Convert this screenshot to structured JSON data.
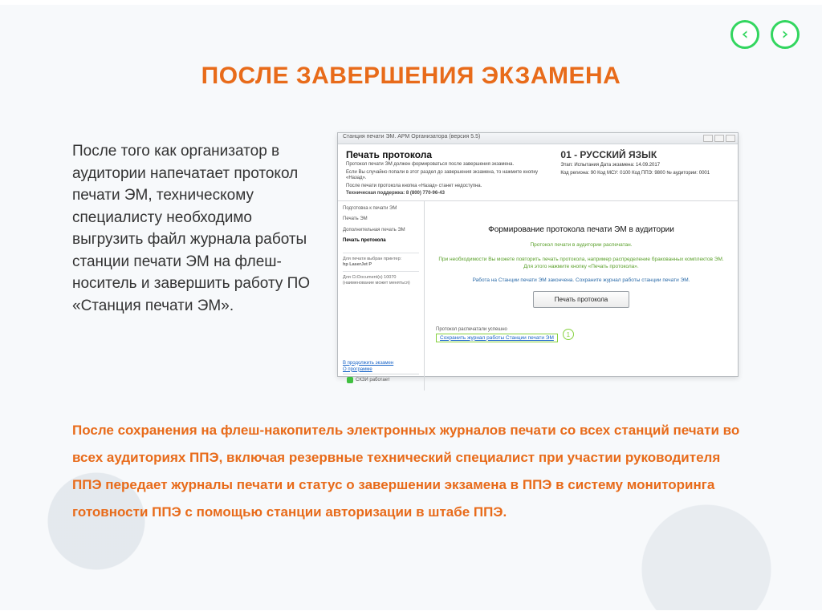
{
  "title": "ПОСЛЕ ЗАВЕРШЕНИЯ ЭКЗАМЕНА",
  "body": "После того как организатор в аудитории напечатает протокол печати ЭМ, техническому специалисту необходимо выгрузить файл журнала работы станции печати ЭМ на флеш-носитель и завершить работу ПО «Станция печати ЭМ».",
  "footer": "После сохранения на флеш-накопитель электронных журналов печати со всех станций печати во всех аудиториях ППЭ, включая резервные технический специалист при участии руководителя ППЭ передает журналы печати и статус        о завершении экзамена в ППЭ в систему мониторинга готовности ППЭ с помощью станции авторизации в штабе ППЭ.",
  "ss": {
    "titlebar": "Станция печати ЭМ. АРМ Организатора (версия 5.5)",
    "header_left_title": "Печать протокола",
    "header_left_sub1": "Протокол печати ЭМ должен формироваться после завершения экзамена.",
    "header_left_sub2": "Если Вы случайно попали в этот раздел до завершения экзамена, то нажмите кнопку «Назад».",
    "header_left_sub3": "После печати протокола кнопка «Назад» станет недоступна.",
    "header_left_support": "Техническая поддержка:  8 (800) 770-96-43",
    "header_right_title": "01 - РУССКИЙ ЯЗЫК",
    "header_right_meta1": "Этап: Испытания   Дата экзамена: 14.09.2017",
    "header_right_meta2": "Код региона: 90   Код МСУ: 0100   Код ППЭ: 9800   № аудитории: 0001",
    "side": {
      "step1": "Подготовка к печати ЭМ",
      "step2": "Печать ЭМ",
      "step3": "Дополнительная печать ЭМ",
      "step4": "Печать протокола",
      "printer_label": "Для печати выбран принтер:",
      "printer_name": "hp LaserJet P",
      "printer_note": "Для Сі:Document(s) 10070 (наименование может меняться)",
      "link1": "В продолжить экзамен",
      "link2": "О программе",
      "status": "СКЗИ работает"
    },
    "main": {
      "title": "Формирование протокола печати ЭМ в аудитории",
      "green1": "Протокол печати в аудитории распечатан.",
      "green2": "При необходимости Вы можете повторить печать протокола, например распределение бракованных комплектов ЭМ. Для этого нажмите кнопку «Печать протокола».",
      "blue": "Работа на Станции печати ЭМ закончена. Сохраните журнал работы станции печати ЭМ.",
      "button": "Печать протокола",
      "done_label": "Протокол распечатали успешно",
      "done_link": "Сохранить журнал работы Станции печати ЭМ",
      "circle": "1"
    }
  }
}
